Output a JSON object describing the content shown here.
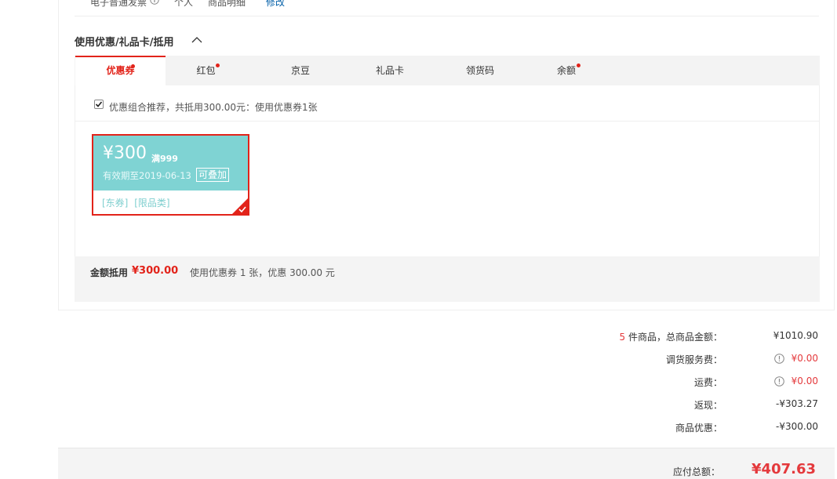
{
  "invoice": {
    "type": "电子普通发票",
    "title": "个人",
    "content": "商品明细",
    "edit_label": "修改"
  },
  "discount_section": {
    "title": "使用优惠/礼品卡/抵用",
    "tabs": [
      {
        "label": "优惠券",
        "active": true,
        "dot": true
      },
      {
        "label": "红包",
        "active": false,
        "dot": true
      },
      {
        "label": "京豆",
        "active": false,
        "dot": false
      },
      {
        "label": "礼品卡",
        "active": false,
        "dot": false
      },
      {
        "label": "领货码",
        "active": false,
        "dot": false
      },
      {
        "label": "余额",
        "active": false,
        "dot": true
      }
    ],
    "recommend": {
      "checked": true,
      "text": "优惠组合推荐，共抵用300.00元：使用优惠券1张"
    },
    "coupon": {
      "amount": "¥300",
      "condition": "满999",
      "validity": "有效期至2019-06-13",
      "badge": "可叠加",
      "tag1": "[东券]",
      "tag2": "[限品类]",
      "selected": true
    },
    "deduction": {
      "label": "金额抵用",
      "amount": "¥300.00",
      "description": "使用优惠券 1 张，优惠 300.00 元"
    }
  },
  "summary": {
    "items_count": "5",
    "items_label": " 件商品，总商品金额：",
    "items_value": "¥1010.90",
    "service_fee_label": "调货服务费：",
    "service_fee_value": "¥0.00",
    "shipping_label": "运费：",
    "shipping_value": "¥0.00",
    "cashback_label": "返现：",
    "cashback_value": "-¥303.27",
    "product_discount_label": "商品优惠：",
    "product_discount_value": "-¥300.00",
    "total_label": "应付总额：",
    "total_value": "¥407.63"
  },
  "colors": {
    "accent_red": "#e2231a",
    "coupon_teal": "#7fd3d3",
    "price_red": "#e4393c"
  }
}
